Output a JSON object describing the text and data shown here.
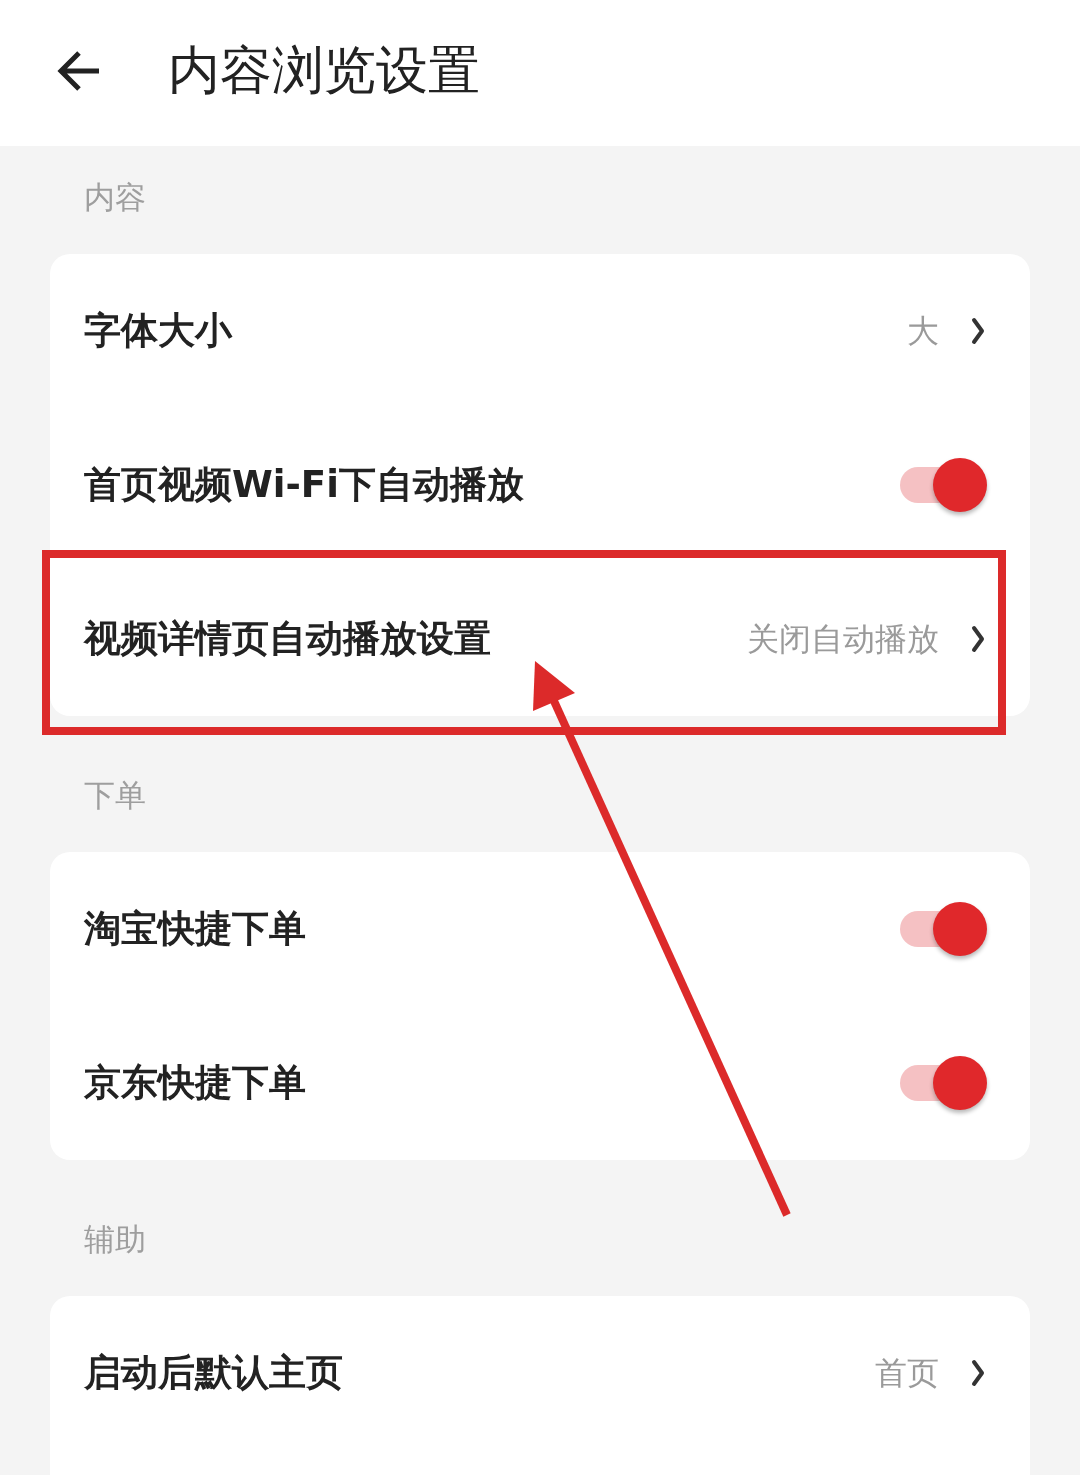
{
  "header": {
    "title": "内容浏览设置"
  },
  "sections": [
    {
      "title": "内容",
      "items": [
        {
          "kind": "link",
          "label": "字体大小",
          "value": "大",
          "highlighted": false
        },
        {
          "kind": "toggle",
          "label": "首页视频Wi-Fi下自动播放",
          "on": true,
          "highlighted": false
        },
        {
          "kind": "link",
          "label": "视频详情页自动播放设置",
          "value": "关闭自动播放",
          "highlighted": true
        }
      ]
    },
    {
      "title": "下单",
      "items": [
        {
          "kind": "toggle",
          "label": "淘宝快捷下单",
          "on": true,
          "highlighted": false
        },
        {
          "kind": "toggle",
          "label": "京东快捷下单",
          "on": true,
          "highlighted": false
        }
      ]
    },
    {
      "title": "辅助",
      "items": [
        {
          "kind": "link",
          "label": "启动后默认主页",
          "value": "首页",
          "highlighted": false
        }
      ]
    }
  ]
}
